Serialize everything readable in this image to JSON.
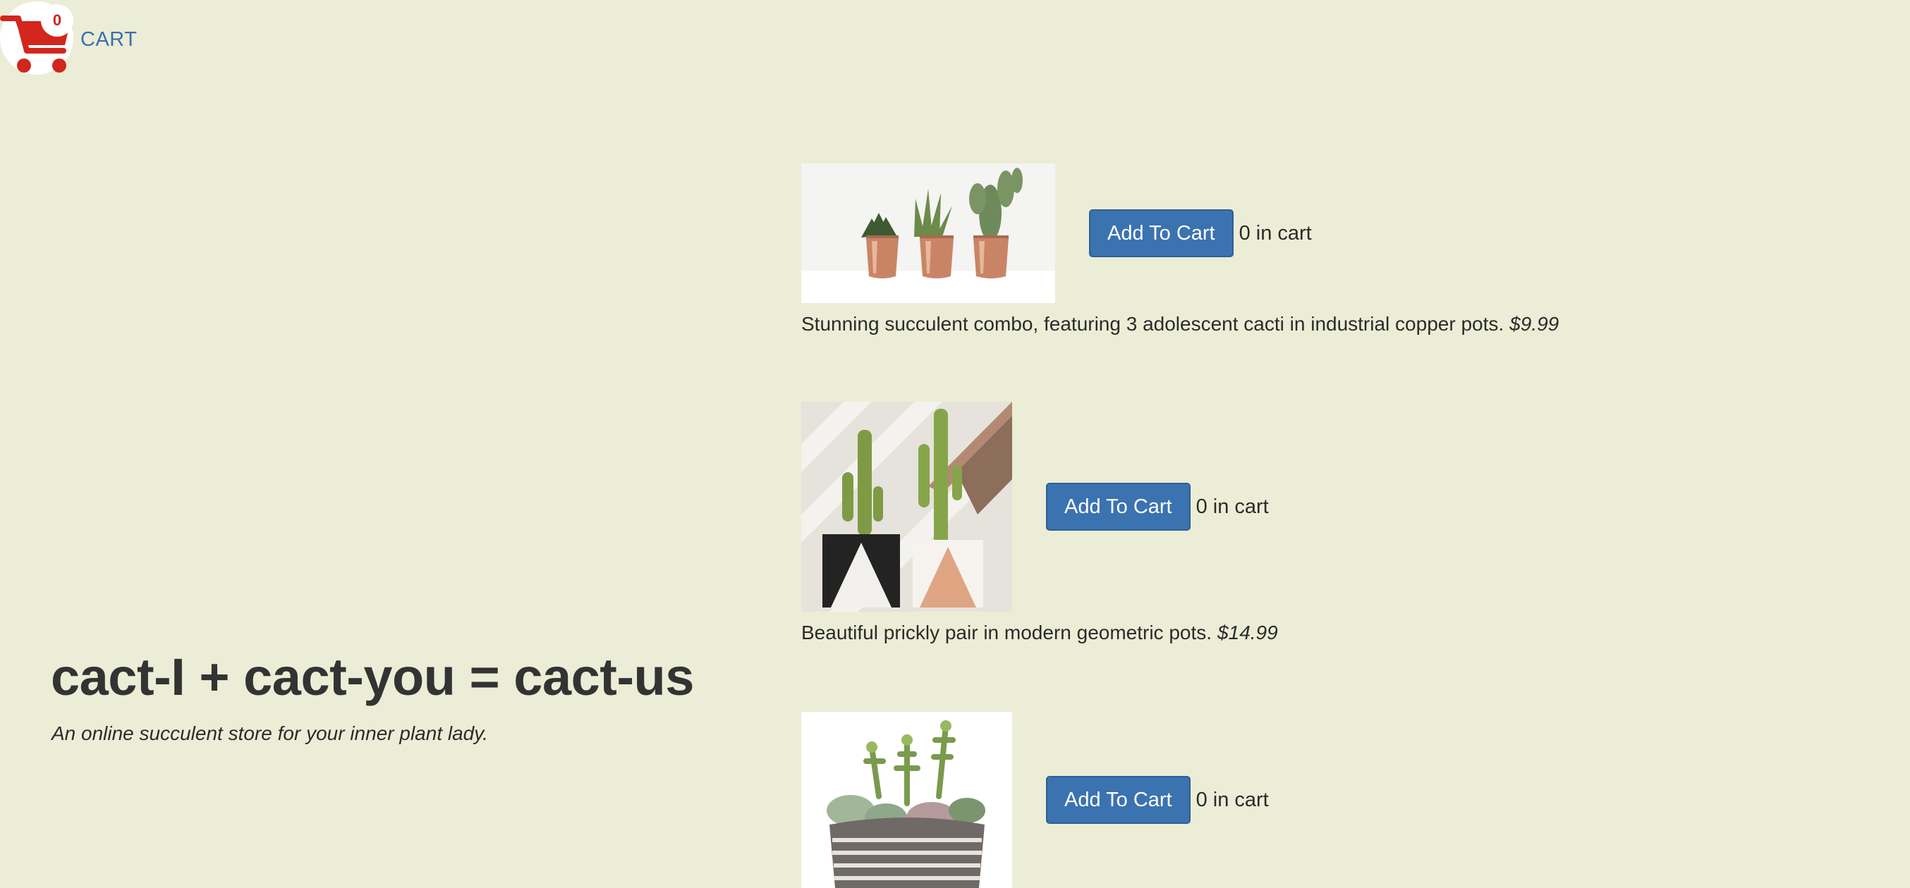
{
  "header": {
    "cart_label": "CART",
    "cart_count": "0",
    "cart_icon": "shopping-cart-icon"
  },
  "hero": {
    "title": "cact-I + cact-you = cact-us",
    "tagline": "An online succulent store for your inner plant lady."
  },
  "products": [
    {
      "image": "three cacti in copper pots",
      "button_label": "Add To Cart",
      "in_cart_count": "0",
      "in_cart_label": "in cart",
      "description": "Stunning succulent combo, featuring 3 adolescent cacti in industrial copper pots.",
      "price": "$9.99"
    },
    {
      "image": "two cacti in geometric pots",
      "button_label": "Add To Cart",
      "in_cart_count": "0",
      "in_cart_label": "in cart",
      "description": "Beautiful prickly pair in modern geometric pots.",
      "price": "$14.99"
    },
    {
      "image": "succulent arrangement in striped bowl",
      "button_label": "Add To Cart",
      "in_cart_count": "0",
      "in_cart_label": "in cart",
      "description": "",
      "price": ""
    }
  ],
  "colors": {
    "background": "#ecedd6",
    "button": "#3b72b0",
    "cart_red": "#d3261c",
    "link": "#3a6fae"
  }
}
